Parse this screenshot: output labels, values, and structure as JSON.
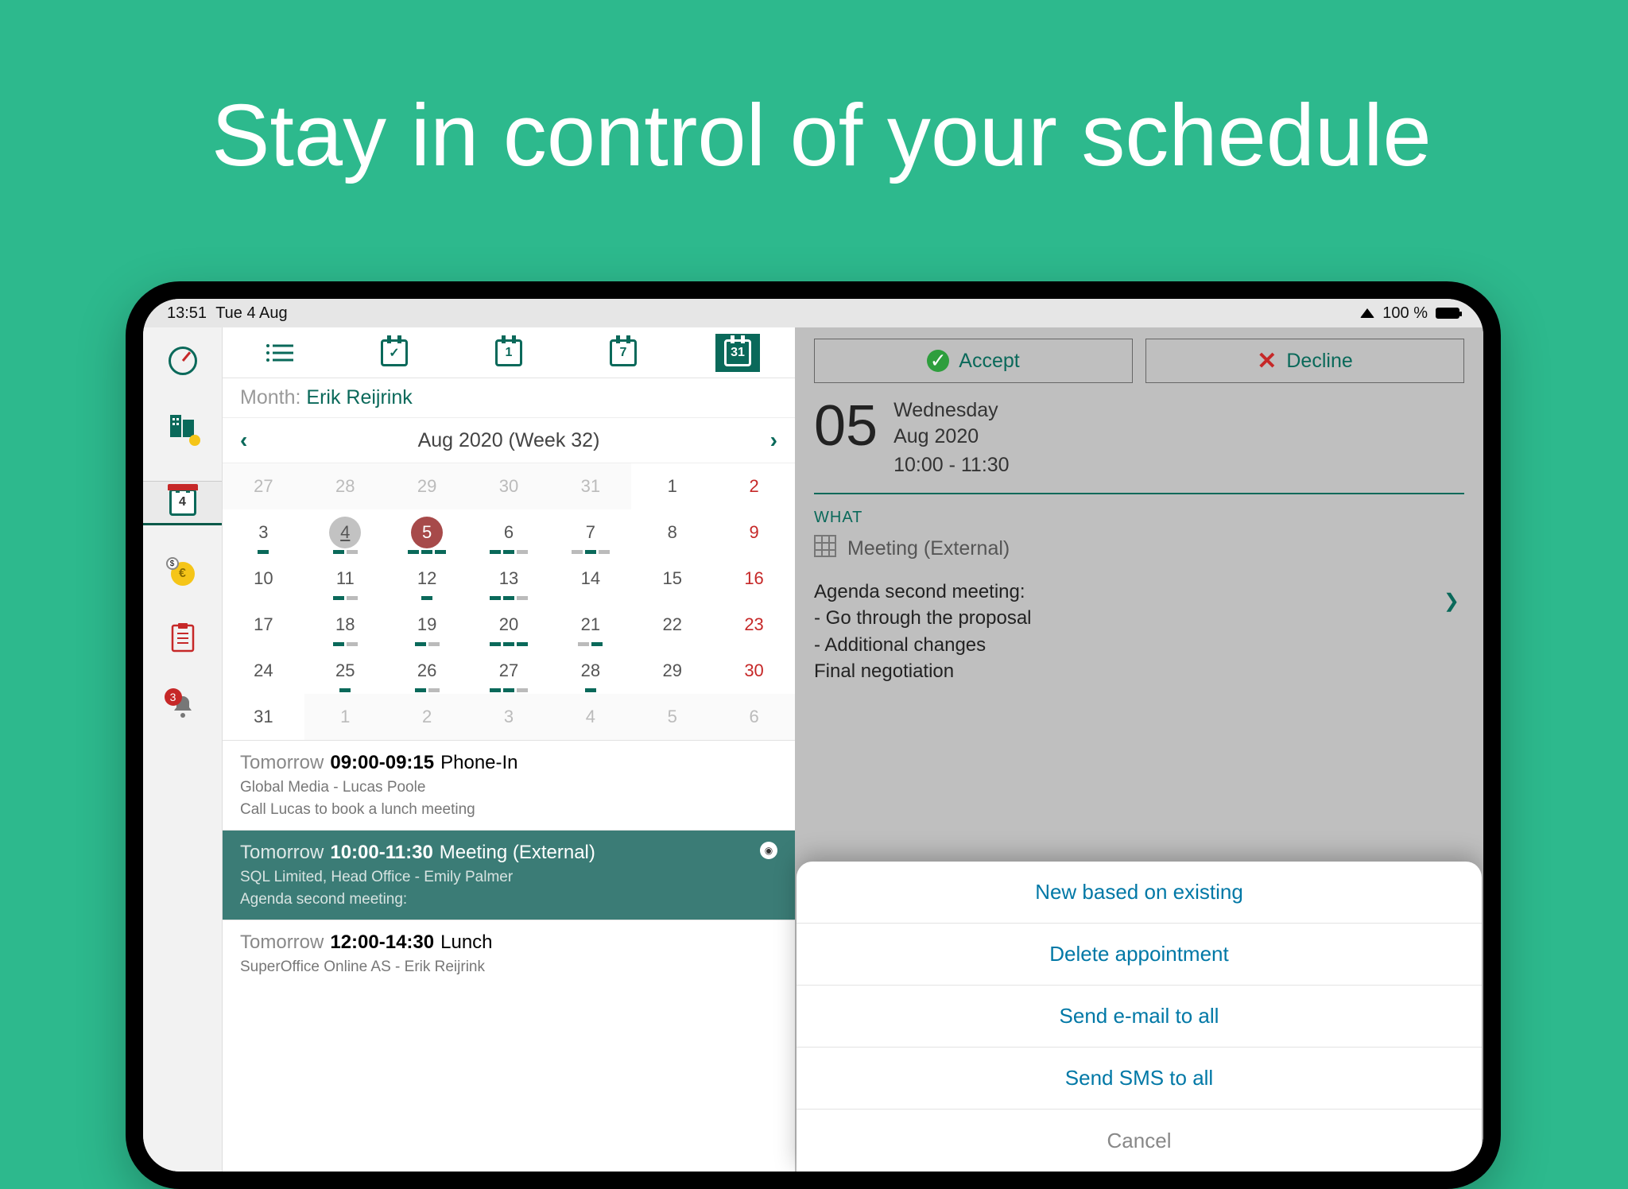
{
  "headline": "Stay in control of your schedule",
  "statusbar": {
    "time": "13:51",
    "date": "Tue 4 Aug",
    "battery": "100 %"
  },
  "views": {
    "day": "1",
    "week": "7",
    "month": "31"
  },
  "sidebar": {
    "calendar_badge": "4",
    "bell_badge": "3"
  },
  "month": {
    "label": "Month:",
    "user": "Erik Reijrink",
    "title": "Aug 2020  (Week 32)",
    "rows": [
      [
        {
          "n": "27",
          "dim": true
        },
        {
          "n": "28",
          "dim": true
        },
        {
          "n": "29",
          "dim": true
        },
        {
          "n": "30",
          "dim": true
        },
        {
          "n": "31",
          "dim": true
        },
        {
          "n": "1"
        },
        {
          "n": "2",
          "sun": true
        }
      ],
      [
        {
          "n": "3",
          "mk": [
            1
          ]
        },
        {
          "n": "4",
          "today": true,
          "mk": [
            1,
            0
          ]
        },
        {
          "n": "5",
          "sel": true,
          "mk": [
            1,
            1,
            1
          ]
        },
        {
          "n": "6",
          "mk": [
            1,
            1,
            0
          ]
        },
        {
          "n": "7",
          "mk": [
            0,
            1,
            0
          ]
        },
        {
          "n": "8"
        },
        {
          "n": "9",
          "sun": true
        }
      ],
      [
        {
          "n": "10"
        },
        {
          "n": "11",
          "mk": [
            1,
            0
          ]
        },
        {
          "n": "12",
          "mk": [
            1
          ]
        },
        {
          "n": "13",
          "mk": [
            1,
            1,
            0
          ]
        },
        {
          "n": "14"
        },
        {
          "n": "15"
        },
        {
          "n": "16",
          "sun": true
        }
      ],
      [
        {
          "n": "17"
        },
        {
          "n": "18",
          "mk": [
            1,
            0
          ]
        },
        {
          "n": "19",
          "mk": [
            1,
            0
          ]
        },
        {
          "n": "20",
          "mk": [
            1,
            1,
            1
          ]
        },
        {
          "n": "21",
          "mk": [
            0,
            1
          ]
        },
        {
          "n": "22"
        },
        {
          "n": "23",
          "sun": true
        }
      ],
      [
        {
          "n": "24"
        },
        {
          "n": "25",
          "mk": [
            1
          ]
        },
        {
          "n": "26",
          "mk": [
            1,
            0
          ]
        },
        {
          "n": "27",
          "mk": [
            1,
            1,
            0
          ]
        },
        {
          "n": "28",
          "mk": [
            1
          ]
        },
        {
          "n": "29"
        },
        {
          "n": "30",
          "sun": true
        }
      ],
      [
        {
          "n": "31"
        },
        {
          "n": "1",
          "dim": true
        },
        {
          "n": "2",
          "dim": true
        },
        {
          "n": "3",
          "dim": true
        },
        {
          "n": "4",
          "dim": true
        },
        {
          "n": "5",
          "dim": true
        },
        {
          "n": "6",
          "dim": true
        }
      ]
    ]
  },
  "list": [
    {
      "day": "Tomorrow",
      "time": "09:00-09:15",
      "type": "Phone-In",
      "sub": "Global Media  -  Lucas Poole",
      "desc": "Call Lucas to book a lunch meeting"
    },
    {
      "day": "Tomorrow",
      "time": "10:00-11:30",
      "type": "Meeting (External)",
      "sub": "SQL Limited, Head Office  -  Emily Palmer",
      "desc": "Agenda second meeting:",
      "sel": true,
      "eye": true
    },
    {
      "day": "Tomorrow",
      "time": "12:00-14:30",
      "type": "Lunch",
      "sub": "SuperOffice Online AS  -  Erik Reijrink",
      "desc": ""
    }
  ],
  "detail": {
    "accept": "Accept",
    "decline": "Decline",
    "daynum": "05",
    "weekday": "Wednesday",
    "monthyear": "Aug 2020",
    "time": "10:00 - 11:30",
    "what_label": "WHAT",
    "what_value": "Meeting (External)",
    "agenda": "Agenda second meeting:\n- Go through the proposal\n- Additional changes\n  Final negotiation"
  },
  "sheet": {
    "new": "New based on existing",
    "delete": "Delete appointment",
    "email": "Send e-mail to all",
    "sms": "Send SMS to all",
    "cancel": "Cancel"
  }
}
